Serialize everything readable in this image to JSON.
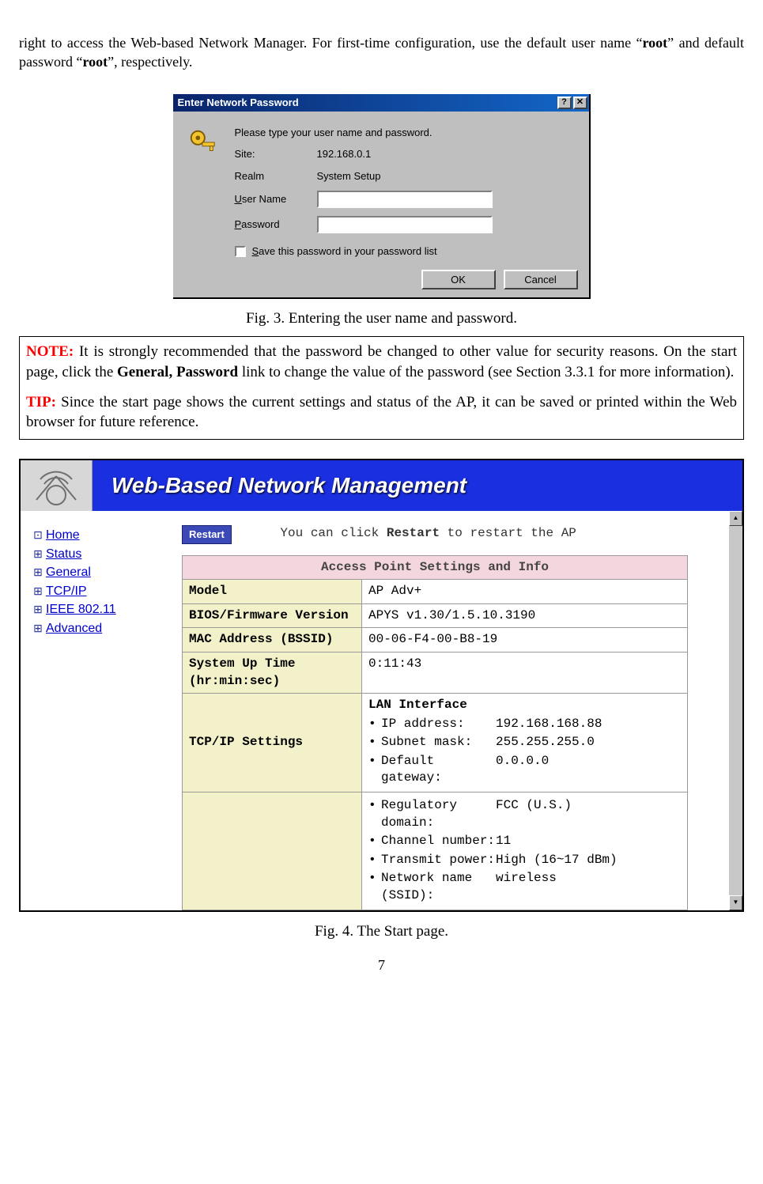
{
  "intro": {
    "line1": "right to access the Web-based Network Manager. For first-time configuration, use the default user name “",
    "root1": "root",
    "line2": "” and default password “",
    "root2": "root",
    "line3": "”, respectively."
  },
  "dlg": {
    "title": "Enter Network Password",
    "help": "?",
    "close": "✕",
    "instr": "Please type your user name and password.",
    "site_lbl": "Site:",
    "site_val": "192.168.0.1",
    "realm_lbl": "Realm",
    "realm_val": "System Setup",
    "user_u": "U",
    "user_rest": "ser Name",
    "pass_u": "P",
    "pass_rest": "assword",
    "save_u": "S",
    "save_rest": "ave this password in your password list",
    "ok": "OK",
    "cancel": "Cancel"
  },
  "fig3_caption": "Fig. 3. Entering the user name and password.",
  "note": {
    "note_lbl": "NOTE:",
    "note_body": " It is strongly recommended that the password be changed to other value for security reasons. On the start page, click the ",
    "note_bold": "General, Password",
    "note_end": " link to change the value of the password (see Section 3.3.1 for more information).",
    "tip_lbl": "TIP:",
    "tip_body": " Since the start page shows the current settings and status of the AP, it can be saved or printed within the Web browser for future reference."
  },
  "wb": {
    "title": "Web-Based Network Management",
    "nav": [
      "Home",
      "Status",
      "General",
      "TCP/IP",
      "IEEE 802.11",
      "Advanced"
    ],
    "restart": "Restart",
    "hint1": "You can click ",
    "hint_b": "Restart",
    "hint2": " to restart the AP",
    "caption": "Access Point Settings and Info",
    "rows": {
      "model_k": "Model",
      "model_v": "AP Adv+",
      "bios_k": "BIOS/Firmware Version",
      "bios_v": "APYS v1.30/1.5.10.3190",
      "mac_k": "MAC Address (BSSID)",
      "mac_v": "00-06-F4-00-B8-19",
      "up_k1": "System Up Time",
      "up_k2": "(hr:min:sec)",
      "up_v": "0:11:43",
      "tcp_k": "TCP/IP Settings",
      "lan_hdr": "LAN Interface",
      "ip_k": "IP address:",
      "ip_v": "192.168.168.88",
      "mask_k": "Subnet mask:",
      "mask_v": "255.255.255.0",
      "gw_k": "Default gateway:",
      "gw_v": "0.0.0.0",
      "reg_k": "Regulatory domain:",
      "reg_v": "FCC (U.S.)",
      "ch_k": "Channel number:",
      "ch_v": "11",
      "tx_k": "Transmit power:",
      "tx_v": "High (16~17 dBm)",
      "ssid_k": "Network name (SSID):",
      "ssid_v": "wireless"
    }
  },
  "fig4_caption": "Fig. 4. The Start page.",
  "page_num": "7"
}
